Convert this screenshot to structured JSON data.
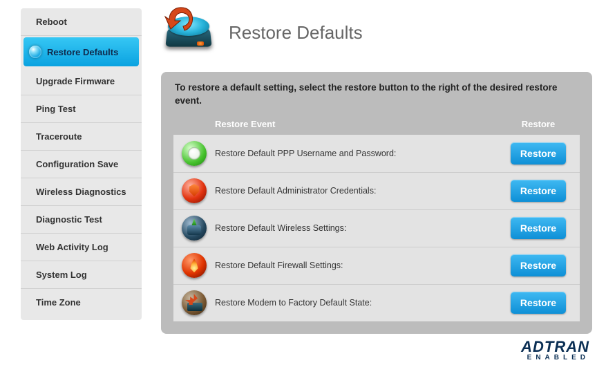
{
  "page_title": "Restore Defaults",
  "intro": "To restore a default setting, select the restore button to the right of the desired restore event.",
  "sidebar": {
    "items": [
      {
        "label": "Reboot",
        "active": false
      },
      {
        "label": "Restore Defaults",
        "active": true
      },
      {
        "label": "Upgrade Firmware",
        "active": false
      },
      {
        "label": "Ping Test",
        "active": false
      },
      {
        "label": "Traceroute",
        "active": false
      },
      {
        "label": "Configuration Save",
        "active": false
      },
      {
        "label": "Wireless Diagnostics",
        "active": false
      },
      {
        "label": "Diagnostic Test",
        "active": false
      },
      {
        "label": "Web Activity Log",
        "active": false
      },
      {
        "label": "System Log",
        "active": false
      },
      {
        "label": "Time Zone",
        "active": false
      }
    ]
  },
  "table": {
    "col_event": "Restore Event",
    "col_action": "Restore",
    "rows": [
      {
        "icon": "clock",
        "label": "Restore Default PPP Username and Password:",
        "button": "Restore"
      },
      {
        "icon": "shield",
        "label": "Restore Default Administrator Credentials:",
        "button": "Restore"
      },
      {
        "icon": "router",
        "label": "Restore Default Wireless Settings:",
        "button": "Restore"
      },
      {
        "icon": "fire",
        "label": "Restore Default Firewall Settings:",
        "button": "Restore"
      },
      {
        "icon": "factory",
        "label": "Restore Modem to Factory Default State:",
        "button": "Restore"
      }
    ]
  },
  "brand": {
    "name": "ADTRAN",
    "tag": "ENABLED"
  }
}
